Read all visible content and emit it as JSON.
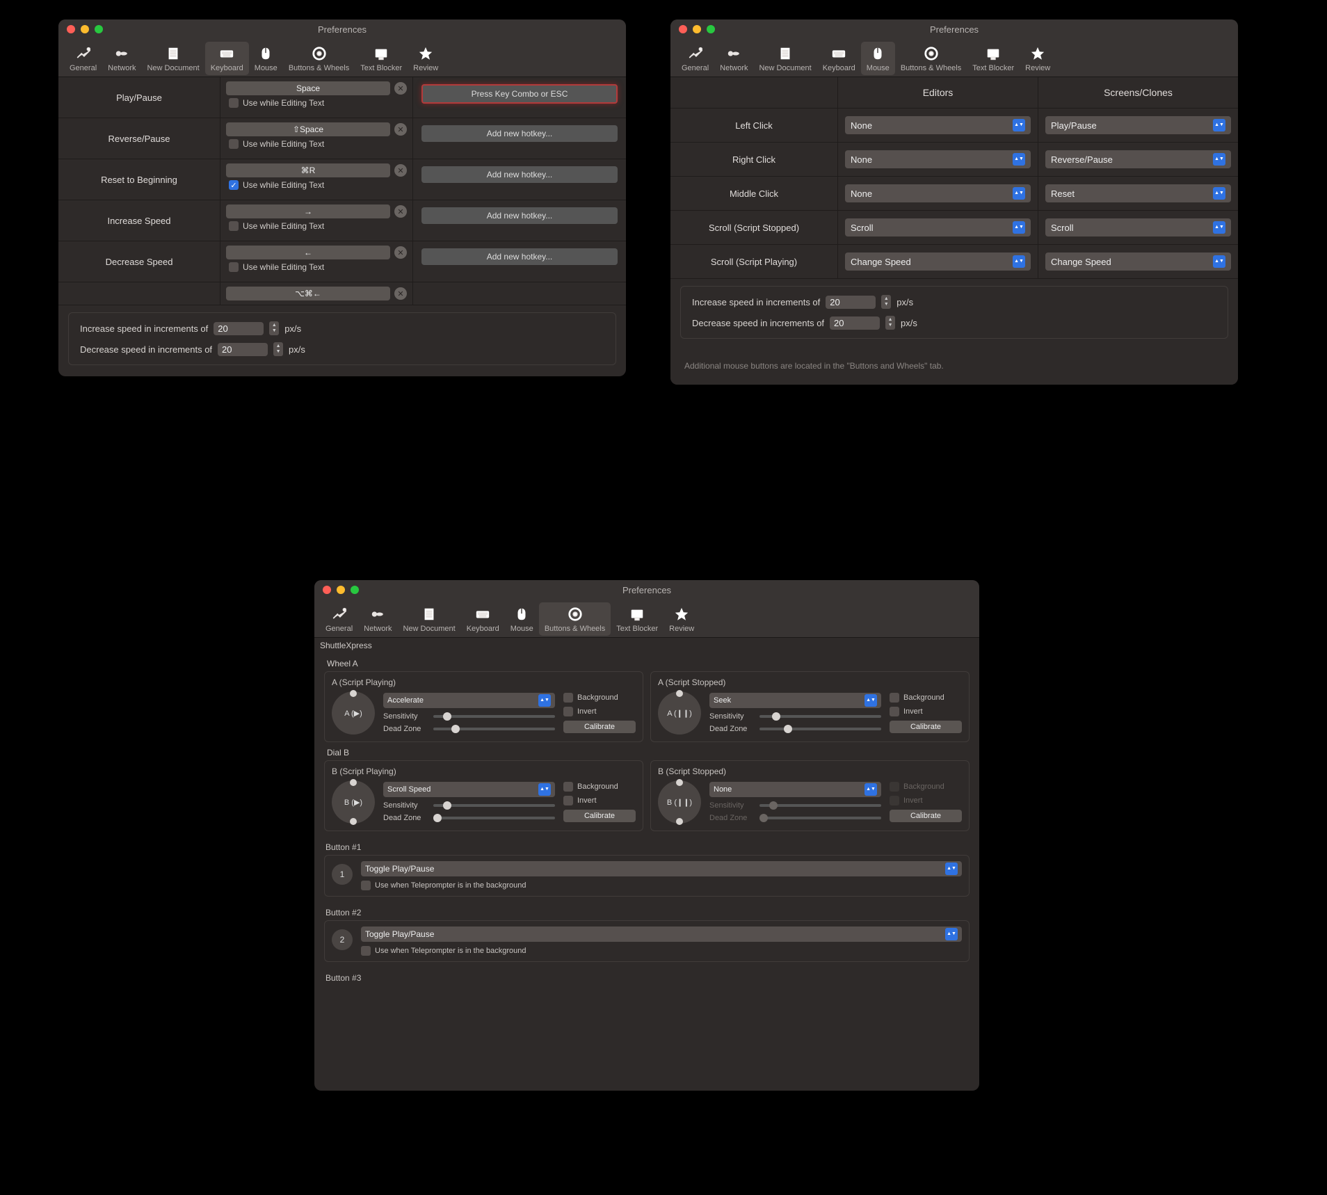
{
  "window_title": "Preferences",
  "toolbar": [
    {
      "label": "General"
    },
    {
      "label": "Network"
    },
    {
      "label": "New Document"
    },
    {
      "label": "Keyboard"
    },
    {
      "label": "Mouse"
    },
    {
      "label": "Buttons & Wheels"
    },
    {
      "label": "Text Blocker"
    },
    {
      "label": "Review"
    }
  ],
  "keyboard": {
    "rows": [
      {
        "label": "Play/Pause",
        "key": "Space",
        "editing_checked": false,
        "right_type": "press"
      },
      {
        "label": "Reverse/Pause",
        "key": "⇧Space",
        "editing_checked": false,
        "right_type": "add"
      },
      {
        "label": "Reset to Beginning",
        "key": "⌘R",
        "editing_checked": true,
        "right_type": "add"
      },
      {
        "label": "Increase Speed",
        "key": "→",
        "editing_checked": false,
        "right_type": "add"
      },
      {
        "label": "Decrease Speed",
        "key": "←",
        "editing_checked": false,
        "right_type": "add"
      }
    ],
    "overflow_key": "⌥⌘←",
    "use_while_editing_label": "Use while Editing Text",
    "press_combo_label": "Press Key Combo or ESC",
    "add_hotkey_label": "Add new hotkey...",
    "increments": {
      "increase_label": "Increase speed in increments of",
      "decrease_label": "Decrease speed in increments of",
      "increase_value": "20",
      "decrease_value": "20",
      "unit": "px/s"
    }
  },
  "mouse": {
    "col_editors": "Editors",
    "col_screens": "Screens/Clones",
    "rows": [
      {
        "label": "Left Click",
        "editors": "None",
        "screens": "Play/Pause"
      },
      {
        "label": "Right Click",
        "editors": "None",
        "screens": "Reverse/Pause"
      },
      {
        "label": "Middle Click",
        "editors": "None",
        "screens": "Reset"
      },
      {
        "label": "Scroll (Script Stopped)",
        "editors": "Scroll",
        "screens": "Scroll"
      },
      {
        "label": "Scroll (Script Playing)",
        "editors": "Change Speed",
        "screens": "Change Speed"
      }
    ],
    "increments": {
      "increase_label": "Increase speed in increments of",
      "decrease_label": "Decrease speed in increments of",
      "increase_value": "20",
      "decrease_value": "20",
      "unit": "px/s"
    },
    "note": "Additional mouse buttons are located in the \"Buttons and Wheels\" tab."
  },
  "bw": {
    "device": "ShuttleXpress",
    "wheel_a_title": "Wheel A",
    "dial_b_title": "Dial B",
    "playing_label": "A (Script Playing)",
    "stopped_label": "A (Script Stopped)",
    "b_playing_label": "B (Script Playing)",
    "b_stopped_label": "B (Script Stopped)",
    "dial_play": "A (▶)",
    "dial_pause": "A (❙❙)",
    "dial_b_play": "B (▶)",
    "dial_b_pause": "B (❙❙)",
    "a_play_action": "Accelerate",
    "a_stop_action": "Seek",
    "b_play_action": "Scroll Speed",
    "b_stop_action": "None",
    "sensitivity": "Sensitivity",
    "deadzone": "Dead Zone",
    "background": "Background",
    "invert": "Invert",
    "calibrate": "Calibrate",
    "button1_title": "Button #1",
    "button2_title": "Button #2",
    "button3_title": "Button #3",
    "button_action": "Toggle Play/Pause",
    "button_bg": "Use when Teleprompter is in the background"
  }
}
